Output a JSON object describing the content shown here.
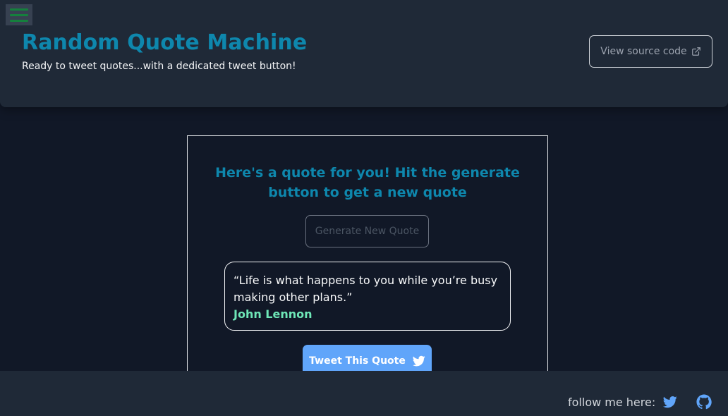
{
  "header": {
    "menu_icon": "hamburger-menu-icon",
    "title": "Random Quote Machine",
    "subtitle": "Ready to tweet quotes...with a dedicated tweet button!",
    "source_button_label": "View source code",
    "source_button_icon": "external-link-icon"
  },
  "card": {
    "heading": "Here's a quote for you! Hit the generate button to get a new quote",
    "generate_button_label": "Generate New Quote",
    "quote": {
      "text": "“Life is what happens to you while you’re busy making other plans.”",
      "author": "John Lennon"
    },
    "tweet_button_label": "Tweet This Quote",
    "tweet_button_icon": "twitter-icon"
  },
  "footer": {
    "follow_label": "follow me here:",
    "icons": [
      "twitter-icon",
      "github-icon"
    ]
  },
  "colors": {
    "background": "#111827",
    "header_bg": "#1f2937",
    "accent": "#0e87ad",
    "author": "#6ee7b7",
    "tweet_button": "#60a5fa",
    "menu_lines": "#15803d"
  }
}
